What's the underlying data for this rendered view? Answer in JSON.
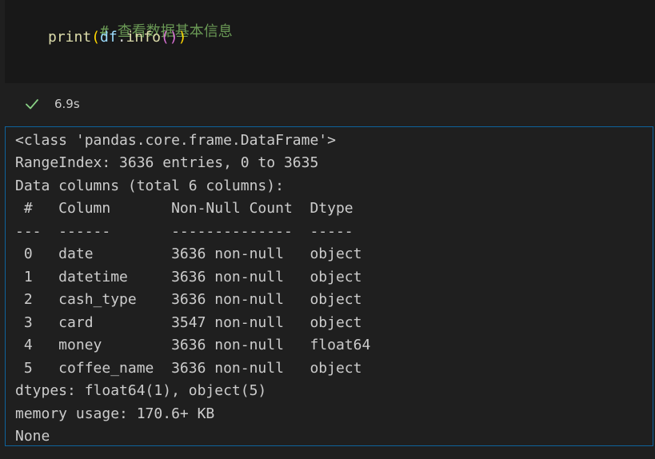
{
  "code_cell": {
    "comment": "# 查看数据基本信息",
    "code": {
      "fn": "print",
      "open1": "(",
      "var": "df",
      "dot": ".",
      "method": "info",
      "open2": "(",
      "close2": ")",
      "close1": ")"
    },
    "status": {
      "icon": "check-icon",
      "time": "6.9s",
      "color": "#89d185"
    }
  },
  "output": {
    "lines": [
      "<class 'pandas.core.frame.DataFrame'>",
      "RangeIndex: 3636 entries, 0 to 3635",
      "Data columns (total 6 columns):",
      " #   Column       Non-Null Count  Dtype  ",
      "---  ------       --------------  -----  ",
      " 0   date         3636 non-null   object ",
      " 1   datetime     3636 non-null   object ",
      " 2   cash_type    3636 non-null   object ",
      " 3   card         3547 non-null   object ",
      " 4   money        3636 non-null   float64",
      " 5   coffee_name  3636 non-null   object ",
      "dtypes: float64(1), object(5)",
      "memory usage: 170.6+ KB",
      "None"
    ]
  },
  "colors": {
    "background": "#1f1f1f",
    "editor": "#181818",
    "output_border": "#0e639c",
    "comment": "#6a9955",
    "function": "#dcdcaa",
    "variable": "#9cdcfe"
  }
}
